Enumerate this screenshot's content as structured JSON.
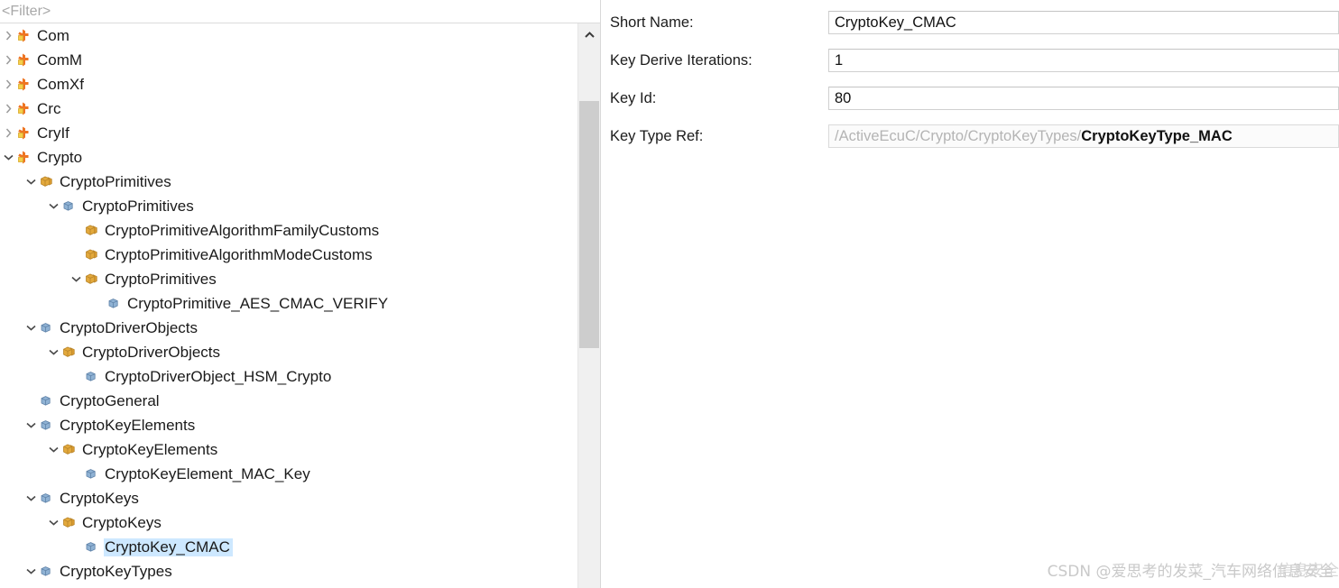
{
  "tree_panel": {
    "filter": {
      "placeholder": "<Filter>",
      "value": ""
    },
    "rows": [
      {
        "label": "Com",
        "depth": 0,
        "icon": "module-icon",
        "twisty": "collapsed",
        "selected": false
      },
      {
        "label": "ComM",
        "depth": 0,
        "icon": "module-icon",
        "twisty": "collapsed",
        "selected": false
      },
      {
        "label": "ComXf",
        "depth": 0,
        "icon": "module-icon",
        "twisty": "collapsed",
        "selected": false
      },
      {
        "label": "Crc",
        "depth": 0,
        "icon": "module-icon",
        "twisty": "collapsed",
        "selected": false
      },
      {
        "label": "CryIf",
        "depth": 0,
        "icon": "module-icon",
        "twisty": "collapsed",
        "selected": false
      },
      {
        "label": "Crypto",
        "depth": 0,
        "icon": "module-icon",
        "twisty": "expanded",
        "selected": false
      },
      {
        "label": "CryptoPrimitives",
        "depth": 1,
        "icon": "container-icon",
        "twisty": "expanded",
        "selected": false
      },
      {
        "label": "CryptoPrimitives",
        "depth": 2,
        "icon": "element-icon",
        "twisty": "expanded",
        "selected": false
      },
      {
        "label": "CryptoPrimitiveAlgorithmFamilyCustoms",
        "depth": 3,
        "icon": "container-icon",
        "twisty": "none",
        "selected": false
      },
      {
        "label": "CryptoPrimitiveAlgorithmModeCustoms",
        "depth": 3,
        "icon": "container-icon",
        "twisty": "none",
        "selected": false
      },
      {
        "label": "CryptoPrimitives",
        "depth": 3,
        "icon": "container-icon",
        "twisty": "expanded",
        "selected": false
      },
      {
        "label": "CryptoPrimitive_AES_CMAC_VERIFY",
        "depth": 4,
        "icon": "element-icon",
        "twisty": "none",
        "selected": false
      },
      {
        "label": "CryptoDriverObjects",
        "depth": 1,
        "icon": "element-icon",
        "twisty": "expanded",
        "selected": false
      },
      {
        "label": "CryptoDriverObjects",
        "depth": 2,
        "icon": "container-icon",
        "twisty": "expanded",
        "selected": false
      },
      {
        "label": "CryptoDriverObject_HSM_Crypto",
        "depth": 3,
        "icon": "element-icon",
        "twisty": "none",
        "selected": false
      },
      {
        "label": "CryptoGeneral",
        "depth": 1,
        "icon": "element-icon",
        "twisty": "none",
        "selected": false
      },
      {
        "label": "CryptoKeyElements",
        "depth": 1,
        "icon": "element-icon",
        "twisty": "expanded",
        "selected": false
      },
      {
        "label": "CryptoKeyElements",
        "depth": 2,
        "icon": "container-icon",
        "twisty": "expanded",
        "selected": false
      },
      {
        "label": "CryptoKeyElement_MAC_Key",
        "depth": 3,
        "icon": "element-icon",
        "twisty": "none",
        "selected": false
      },
      {
        "label": "CryptoKeys",
        "depth": 1,
        "icon": "element-icon",
        "twisty": "expanded",
        "selected": false
      },
      {
        "label": "CryptoKeys",
        "depth": 2,
        "icon": "container-icon",
        "twisty": "expanded",
        "selected": false
      },
      {
        "label": "CryptoKey_CMAC",
        "depth": 3,
        "icon": "element-icon",
        "twisty": "none",
        "selected": true
      },
      {
        "label": "CryptoKeyTypes",
        "depth": 1,
        "icon": "element-icon",
        "twisty": "expanded",
        "selected": false
      }
    ],
    "scrollbar": {
      "up_arrow_icon": "chevron-up-icon"
    }
  },
  "properties_panel": {
    "fields": [
      {
        "label": "Short Name:",
        "value": "CryptoKey_CMAC",
        "readonly": false
      },
      {
        "label": "Key Derive Iterations:",
        "value": "1",
        "readonly": false
      },
      {
        "label": "Key Id:",
        "value": "80",
        "readonly": false
      }
    ],
    "key_type_ref": {
      "label": "Key Type Ref:",
      "path_prefix": "/ActiveEcuC/Crypto/CryptoKeyTypes/",
      "path_leaf": "CryptoKeyType_MAC"
    }
  },
  "watermark": {
    "text": "CSDN @爱思考的发菜_汽车网络信息安全",
    "ghost": "信息安全"
  },
  "colors": {
    "selection": "#cde8ff",
    "module_icon": "#ec7424",
    "container_icon": "#e0a33a",
    "element_icon": "#7b9fc4",
    "placeholder_text": "#a8a8a8"
  }
}
